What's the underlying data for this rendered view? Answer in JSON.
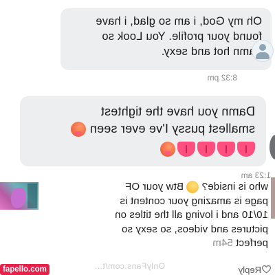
{
  "messages": [
    {
      "lines": [
        "Oh my God, i am so glad, i have",
        "found your profile. You Look so",
        "damn hot and sexy."
      ],
      "time": "8:32 pm"
    },
    {
      "lines": [
        "Damn you have the tightest",
        "smallest pussy I've ever seen"
      ],
      "time": "1:23 am"
    }
  ],
  "comment": {
    "lines": [
      "who is inside?",
      "Btw your OF",
      "page is amazing  your content is",
      "10/10 and i loving all the titles on",
      "pictures and videos, so sexy so",
      "perfect"
    ],
    "time": "54m",
    "reply_label": "Reply"
  },
  "watermark": "OnlyFans.com/t...",
  "site_badge": "fapello.com",
  "icons": [
    "avatar-icon",
    "hot-face-emoji",
    "tongue-emoji",
    "smirk-emoji",
    "heart-icon"
  ]
}
